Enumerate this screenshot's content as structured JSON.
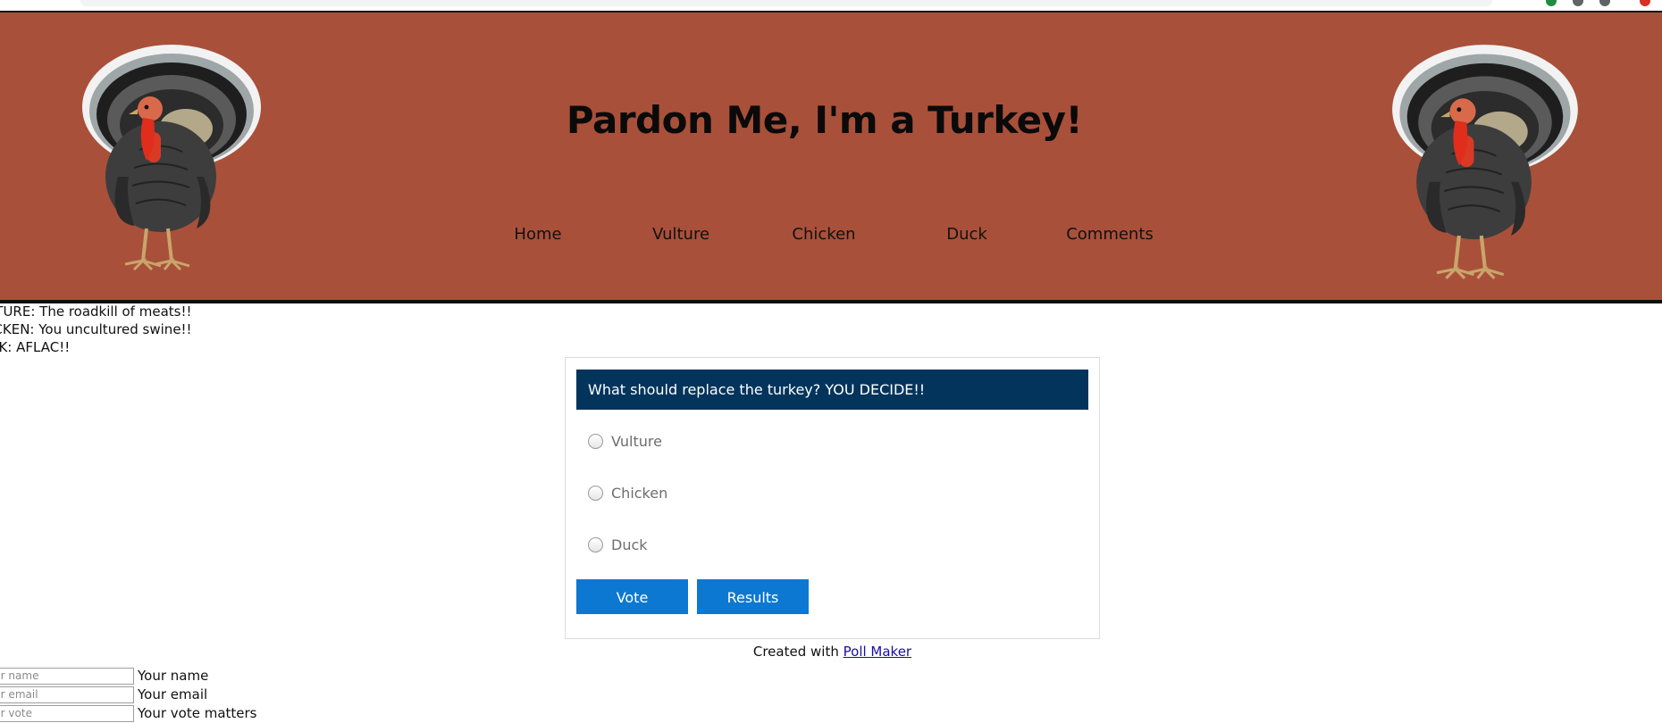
{
  "header": {
    "title": "Pardon Me, I'm a Turkey!",
    "background_color": "#a9503a"
  },
  "nav": {
    "items": [
      "Home",
      "Vulture",
      "Chicken",
      "Duck",
      "Comments"
    ]
  },
  "notes": [
    "LTURE: The roadkill of meats!!",
    "ICKEN: You uncultured swine!!",
    "CK: AFLAC!!"
  ],
  "poll": {
    "question": "What should replace the turkey? YOU DECIDE!!",
    "options": [
      "Vulture",
      "Chicken",
      "Duck"
    ],
    "vote_label": "Vote",
    "results_label": "Results",
    "header_color": "#02345c",
    "button_color": "#0d78d1"
  },
  "credit": {
    "prefix": "Created with",
    "link_text": "Poll Maker"
  },
  "form": {
    "name_placeholder": "Your name",
    "name_label": "Your name",
    "email_placeholder": "Your email",
    "email_label": "Your email",
    "vote_placeholder": "Your vote",
    "vote_label": "Your vote matters"
  }
}
